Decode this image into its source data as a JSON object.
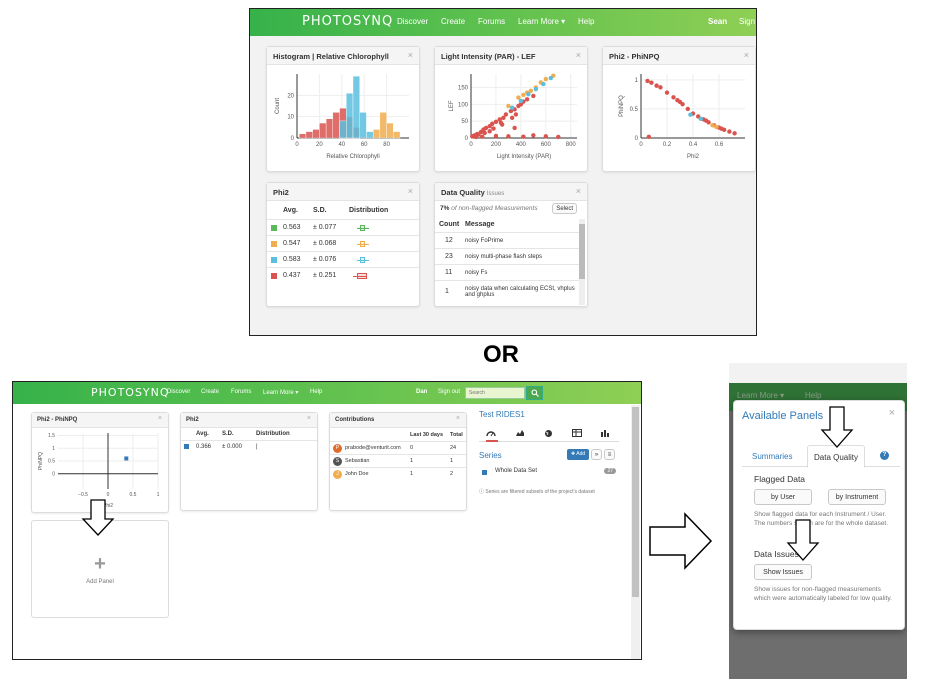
{
  "top": {
    "nav": {
      "logo": "PHOTOSYNQ",
      "items": [
        "Discover",
        "Create",
        "Forums",
        "Learn More ▾",
        "Help"
      ],
      "user": "Sean",
      "signout": "Sign"
    },
    "histogram": {
      "title": "Histogram | Relative Chlorophyll",
      "close": "×",
      "chart_data": {
        "type": "bar",
        "xlabel": "Relative Chlorophyll",
        "ylabel": "Count",
        "xticks": [
          "0",
          "20",
          "40",
          "60",
          "80"
        ],
        "yticks": [
          "0",
          "10",
          "20"
        ],
        "xlim": [
          0,
          100
        ],
        "ylim": [
          0,
          30
        ],
        "series": [
          {
            "color": "#d9534f",
            "bins": [
              [
                5,
                2
              ],
              [
                11,
                3
              ],
              [
                17,
                4
              ],
              [
                23,
                7
              ],
              [
                29,
                9
              ],
              [
                35,
                12
              ],
              [
                41,
                14
              ],
              [
                47,
                10
              ],
              [
                53,
                5
              ]
            ]
          },
          {
            "color": "#5bc0de",
            "bins": [
              [
                41,
                8
              ],
              [
                47,
                21
              ],
              [
                53,
                29
              ],
              [
                59,
                12
              ],
              [
                65,
                3
              ]
            ]
          },
          {
            "color": "#f0ad4e",
            "bins": [
              [
                71,
                4
              ],
              [
                77,
                12
              ],
              [
                83,
                7
              ],
              [
                89,
                3
              ]
            ]
          }
        ]
      }
    },
    "light": {
      "title": "Light Intensity (PAR) - LEF",
      "close": "×",
      "chart_data": {
        "type": "scatter",
        "xlabel": "Light Intensity (PAR)",
        "ylabel": "LEF",
        "xticks": [
          "0",
          "200",
          "400",
          "600",
          "800"
        ],
        "yticks": [
          "0",
          "50",
          "100",
          "150"
        ],
        "xlim": [
          0,
          850
        ],
        "ylim": [
          0,
          190
        ],
        "series": [
          {
            "color": "#d9534f",
            "points": [
              [
                10,
                5
              ],
              [
                30,
                8
              ],
              [
                50,
                12
              ],
              [
                80,
                18
              ],
              [
                100,
                25
              ],
              [
                120,
                30
              ],
              [
                150,
                35
              ],
              [
                170,
                42
              ],
              [
                200,
                48
              ],
              [
                230,
                55
              ],
              [
                260,
                60
              ],
              [
                280,
                70
              ],
              [
                320,
                80
              ],
              [
                350,
                85
              ],
              [
                380,
                95
              ],
              [
                400,
                100
              ],
              [
                420,
                108
              ],
              [
                450,
                115
              ],
              [
                500,
                125
              ],
              [
                40,
                3
              ],
              [
                90,
                4
              ],
              [
                200,
                6
              ],
              [
                300,
                5
              ],
              [
                420,
                4
              ],
              [
                500,
                8
              ],
              [
                600,
                5
              ],
              [
                700,
                3
              ],
              [
                150,
                20
              ],
              [
                250,
                40
              ],
              [
                330,
                60
              ],
              [
                360,
                70
              ],
              [
                110,
                15
              ],
              [
                180,
                28
              ],
              [
                240,
                45
              ],
              [
                60,
                10
              ],
              [
                350,
                30
              ]
            ]
          },
          {
            "color": "#f0ad4e",
            "points": [
              [
                300,
                95
              ],
              [
                380,
                120
              ],
              [
                450,
                135
              ],
              [
                520,
                150
              ],
              [
                560,
                165
              ],
              [
                600,
                175
              ],
              [
                660,
                185
              ],
              [
                420,
                128
              ],
              [
                480,
                140
              ]
            ]
          },
          {
            "color": "#5bc0de",
            "points": [
              [
                330,
                90
              ],
              [
                400,
                110
              ],
              [
                460,
                130
              ],
              [
                520,
                145
              ],
              [
                580,
                160
              ],
              [
                640,
                178
              ]
            ]
          }
        ]
      }
    },
    "phinpq": {
      "title": "Phi2 - PhiNPQ",
      "close": "×",
      "chart_data": {
        "type": "scatter",
        "xlabel": "Phi2",
        "ylabel": "PhiNPQ",
        "xticks": [
          "0",
          "0.2",
          "0.4",
          "0.6"
        ],
        "yticks": [
          "0",
          "0.5",
          "1"
        ],
        "xlim": [
          0,
          0.8
        ],
        "ylim": [
          0,
          1.1
        ],
        "series": [
          {
            "color": "#d9534f",
            "points": [
              [
                0.05,
                0.98
              ],
              [
                0.08,
                0.95
              ],
              [
                0.12,
                0.9
              ],
              [
                0.15,
                0.87
              ],
              [
                0.2,
                0.78
              ],
              [
                0.25,
                0.7
              ],
              [
                0.28,
                0.65
              ],
              [
                0.32,
                0.58
              ],
              [
                0.36,
                0.5
              ],
              [
                0.4,
                0.42
              ],
              [
                0.44,
                0.37
              ],
              [
                0.48,
                0.32
              ],
              [
                0.52,
                0.27
              ],
              [
                0.56,
                0.22
              ],
              [
                0.6,
                0.18
              ],
              [
                0.64,
                0.14
              ],
              [
                0.68,
                0.11
              ],
              [
                0.72,
                0.08
              ],
              [
                0.06,
                0.02
              ],
              [
                0.3,
                0.62
              ],
              [
                0.5,
                0.3
              ],
              [
                0.62,
                0.16
              ]
            ]
          },
          {
            "color": "#5bc0de",
            "points": [
              [
                0.38,
                0.4
              ],
              [
                0.46,
                0.33
              ]
            ]
          },
          {
            "color": "#f0ad4e",
            "points": [
              [
                0.55,
                0.22
              ],
              [
                0.58,
                0.19
              ]
            ]
          }
        ]
      }
    },
    "phi2": {
      "title": "Phi2",
      "close": "×",
      "headers": [
        "Avg.",
        "S.D.",
        "Distribution"
      ],
      "rows": [
        {
          "color": "#5cb85c",
          "avg": "0.563",
          "sd": "± 0.077"
        },
        {
          "color": "#f0ad4e",
          "avg": "0.547",
          "sd": "± 0.068"
        },
        {
          "color": "#5bc0de",
          "avg": "0.583",
          "sd": "± 0.076"
        },
        {
          "color": "#d9534f",
          "avg": "0.437",
          "sd": "± 0.251"
        }
      ]
    },
    "dq": {
      "title": "Data Quality",
      "subtitle": "Issues",
      "close": "×",
      "pct": "7%",
      "pct_text": "of non-flagged Measurements",
      "select": "Select",
      "headers": [
        "Count",
        "Message"
      ],
      "rows": [
        {
          "count": "12",
          "msg": "noisy FoPrime"
        },
        {
          "count": "23",
          "msg": "noisy multi-phase flash steps"
        },
        {
          "count": "11",
          "msg": "noisy Fs"
        },
        {
          "count": "1",
          "msg": "noisy data when calculating ECSt, vhplus and ghplus"
        }
      ]
    }
  },
  "or_label": "OR",
  "bottom": {
    "nav": {
      "logo": "PHOTOSYNQ",
      "items": [
        "Discover",
        "Create",
        "Forums",
        "Learn More ▾",
        "Help"
      ],
      "user": "Dan",
      "signout": "Sign out",
      "search_placeholder": "Search"
    },
    "phinpq": {
      "title": "Phi2 - PhiNPQ",
      "close": "×",
      "chart_data": {
        "type": "scatter",
        "xlabel": "Phi2",
        "ylabel": "PhiNPQ",
        "xticks": [
          "−0.5",
          "0",
          "0.5",
          "1"
        ],
        "yticks": [
          "0",
          "0.5",
          "1",
          "1.5"
        ],
        "xlim": [
          -1,
          1
        ],
        "ylim": [
          -0.6,
          1.6
        ],
        "series": [
          {
            "color": "#337ab7",
            "points": [
              [
                0.366,
                0.6
              ]
            ]
          }
        ]
      }
    },
    "phi2": {
      "title": "Phi2",
      "close": "×",
      "headers": [
        "Avg.",
        "S.D.",
        "Distribution"
      ],
      "row": {
        "color": "#337ab7",
        "avg": "0.366",
        "sd": "± 0.000",
        "dist": "|"
      }
    },
    "contrib": {
      "title": "Contributions",
      "close": "×",
      "headers": [
        "Last 30 days",
        "Total"
      ],
      "rows": [
        {
          "initial": "P",
          "name": "prabode@venturit.com",
          "last": "0",
          "total": "24",
          "color": "#e06c2c"
        },
        {
          "initial": "S",
          "name": "Sebastian",
          "last": "1",
          "total": "1",
          "color": "#555555"
        },
        {
          "initial": "J",
          "name": "John Doe",
          "last": "1",
          "total": "2",
          "color": "#f0ad4e"
        }
      ]
    },
    "add_panel": {
      "plus": "+",
      "label": "Add Panel"
    },
    "project": {
      "title": "Test RIDES1",
      "series_label": "Series",
      "add": "✚ Add",
      "item": "Whole Data Set",
      "badge": "27",
      "note": "Series are filtered subsets of the project's dataset"
    }
  },
  "modal": {
    "bg_nav": [
      "Learn More ▾",
      "Help"
    ],
    "title": "Available Panels",
    "close": "×",
    "tabs": [
      "Summaries",
      "Data Quality"
    ],
    "help": "?",
    "flagged_title": "Flagged Data",
    "by_user": "by User",
    "by_instrument": "by Instrument",
    "flagged_text": "Show flagged data for each Instrument / User. The numbers shown are for the whole dataset.",
    "issues_title": "Data Issues",
    "show_issues": "Show Issues",
    "issues_text": "Show issues for non-flagged measurements which were automatically labeled for low quality."
  }
}
